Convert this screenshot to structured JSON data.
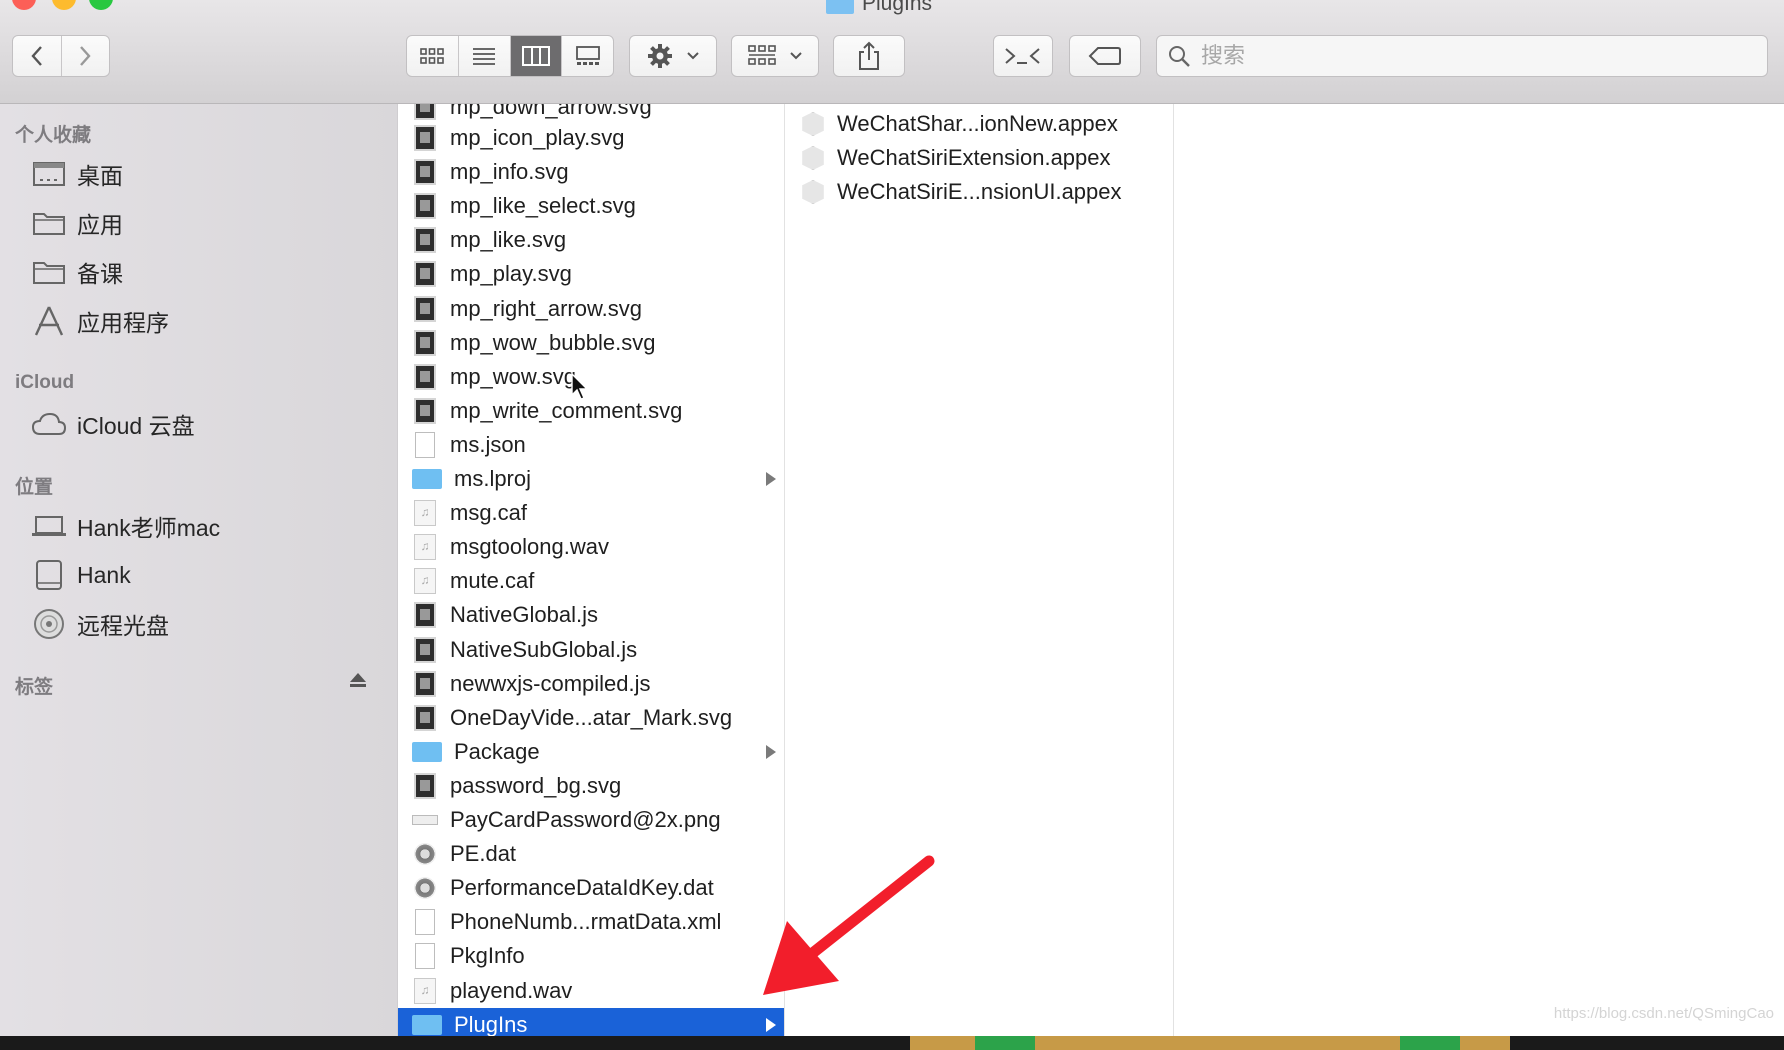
{
  "window": {
    "title": "PlugIns"
  },
  "search": {
    "placeholder": "搜索"
  },
  "sidebar": {
    "favorites_header": "个人收藏",
    "favorites": [
      {
        "label": "桌面",
        "icon": "desktop-icon"
      },
      {
        "label": "应用",
        "icon": "folder-icon"
      },
      {
        "label": "备课",
        "icon": "folder-icon"
      },
      {
        "label": "应用程序",
        "icon": "applications-icon"
      }
    ],
    "icloud_header": "iCloud",
    "icloud": [
      {
        "label": "iCloud 云盘",
        "icon": "cloud-icon"
      }
    ],
    "locations_header": "位置",
    "locations": [
      {
        "label": "Hank老师mac",
        "icon": "laptop-icon"
      },
      {
        "label": "Hank",
        "icon": "disk-icon"
      },
      {
        "label": "远程光盘",
        "icon": "optical-disc-icon"
      }
    ],
    "tags_header": "标签"
  },
  "column1": {
    "partial_top": "mp_down_arrow.svg",
    "items": [
      {
        "name": "mp_icon_play.svg",
        "kind": "svg"
      },
      {
        "name": "mp_info.svg",
        "kind": "svg"
      },
      {
        "name": "mp_like_select.svg",
        "kind": "svg"
      },
      {
        "name": "mp_like.svg",
        "kind": "svg"
      },
      {
        "name": "mp_play.svg",
        "kind": "svg"
      },
      {
        "name": "mp_right_arrow.svg",
        "kind": "svg"
      },
      {
        "name": "mp_wow_bubble.svg",
        "kind": "svg"
      },
      {
        "name": "mp_wow.svg",
        "kind": "svg"
      },
      {
        "name": "mp_write_comment.svg",
        "kind": "svg"
      },
      {
        "name": "ms.json",
        "kind": "doc"
      },
      {
        "name": "ms.lproj",
        "kind": "folder"
      },
      {
        "name": "msg.caf",
        "kind": "audio"
      },
      {
        "name": "msgtoolong.wav",
        "kind": "audio"
      },
      {
        "name": "mute.caf",
        "kind": "audio"
      },
      {
        "name": "NativeGlobal.js",
        "kind": "svg"
      },
      {
        "name": "NativeSubGlobal.js",
        "kind": "svg"
      },
      {
        "name": "newwxjs-compiled.js",
        "kind": "svg"
      },
      {
        "name": "OneDayVide...atar_Mark.svg",
        "kind": "svg"
      },
      {
        "name": "Package",
        "kind": "folder"
      },
      {
        "name": "password_bg.svg",
        "kind": "svg"
      },
      {
        "name": "PayCardPassword@2x.png",
        "kind": "png"
      },
      {
        "name": "PE.dat",
        "kind": "dat"
      },
      {
        "name": "PerformanceDataIdKey.dat",
        "kind": "dat"
      },
      {
        "name": "PhoneNumb...rmatData.xml",
        "kind": "doc"
      },
      {
        "name": "PkgInfo",
        "kind": "doc"
      },
      {
        "name": "playend.wav",
        "kind": "audio"
      },
      {
        "name": "PlugIns",
        "kind": "folder"
      }
    ]
  },
  "column2": {
    "items": [
      "WeChatShar...ionNew.appex",
      "WeChatSiriExtension.appex",
      "WeChatSiriE...nsionUI.appex"
    ]
  },
  "watermark": "https://blog.csdn.net/QSmingCao",
  "colors": {
    "selection": "#1a62d8",
    "folder": "#6fbff2",
    "arrow": "#f21e2b"
  }
}
